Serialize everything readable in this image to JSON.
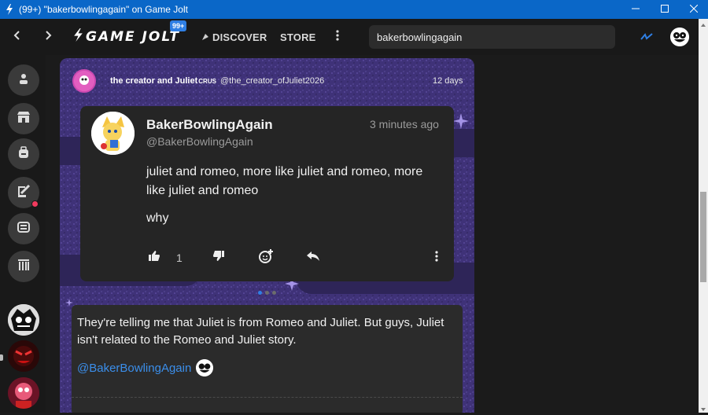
{
  "window": {
    "title": "(99+) \"bakerbowlingagain\" on Game Jolt"
  },
  "nav": {
    "brand": "GAME JOLT",
    "badge": "99+",
    "discover_label": "DISCOVER",
    "store_label": "STORE",
    "search_value": "bakerbowlingagain"
  },
  "post": {
    "creator_name": "the creator and Juliet",
    "creator_tag": "CRUS",
    "creator_handle": "@the_creator_ofJuliet2026",
    "time": "12 days"
  },
  "card": {
    "name": "BakerBowlingAgain",
    "handle": "@BakerBowlingAgain",
    "time": "3 minutes ago",
    "text": "juliet and romeo, more like juliet and romeo, more like juliet and romeo",
    "text2": "why",
    "like_count": "1"
  },
  "comment": {
    "text": "They're telling me that Juliet is from Romeo and Juliet. But guys, Juliet isn't related to the Romeo and Juliet story.",
    "mention": "@BakerBowlingAgain"
  },
  "colors": {
    "titlebar": "#0a67c8",
    "accent": "#2f7fe4",
    "notification": "#f23a5e",
    "mention": "#3b8eea"
  },
  "icons": [
    "gamejolt-bolt-icon",
    "back-arrow-icon",
    "forward-arrow-icon",
    "discover-icon",
    "more-vertical-icon",
    "activity-icon",
    "user-icon",
    "shop-icon",
    "backpack-icon",
    "quest-icon",
    "tv-icon",
    "library-icon",
    "like-icon",
    "dislike-icon",
    "sticker-add-icon",
    "reply-icon",
    "minimize-icon",
    "maximize-icon",
    "close-icon"
  ]
}
